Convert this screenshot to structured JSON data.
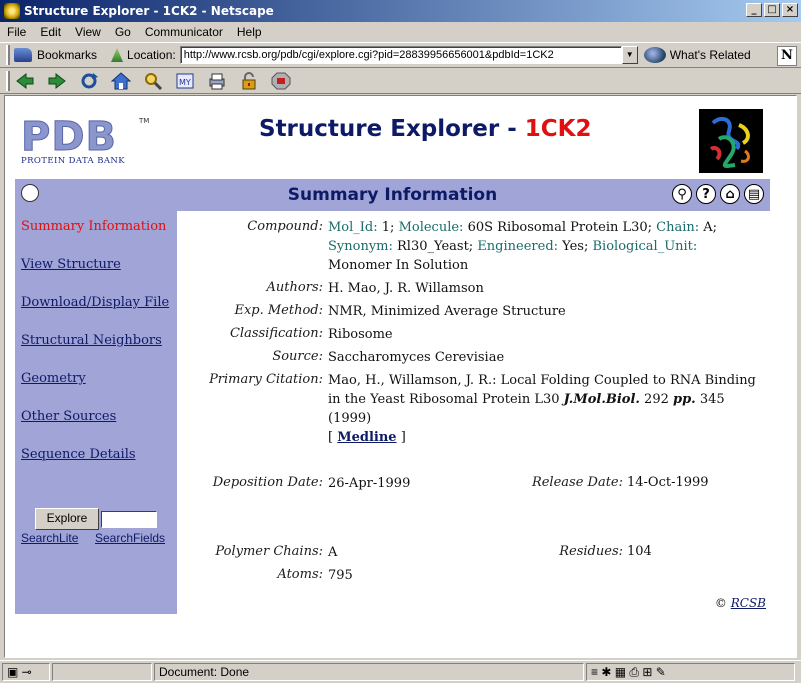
{
  "window": {
    "title": "Structure Explorer - 1CK2 - Netscape",
    "buttons": [
      "_",
      "□",
      "×"
    ]
  },
  "menu": [
    "File",
    "Edit",
    "View",
    "Go",
    "Communicator",
    "Help"
  ],
  "location": {
    "bookmarks_label": "Bookmarks",
    "location_label": "Location:",
    "url": "http://www.rcsb.org/pdb/cgi/explore.cgi?pid=28839956656001&pdbId=1CK2",
    "whats_related": "What's Related",
    "logo": "N"
  },
  "nav_icons": [
    "back-icon",
    "forward-icon",
    "reload-icon",
    "home-icon",
    "search-icon",
    "my-netscape-icon",
    "print-icon",
    "security-icon",
    "stop-icon"
  ],
  "page": {
    "logo_letters": "PDB",
    "logo_tm": "TM",
    "logo_sub": "PROTEIN DATA BANK",
    "heading_prefix": "Structure Explorer - ",
    "heading_id": "1CK2",
    "summary_title": "Summary Information",
    "sidebar": [
      "Summary Information",
      "View Structure",
      "Download/Display File",
      "Structural Neighbors",
      "Geometry",
      "Other Sources",
      "Sequence Details"
    ],
    "explore_button": "Explore",
    "searchlite": "SearchLite",
    "searchfields": "SearchFields",
    "fields": {
      "compound_label": "Compound:",
      "mol_id_key": "Mol_Id:",
      "mol_id_val": " 1; ",
      "molecule_key": "Molecule:",
      "molecule_val": " 60S Ribosomal Protein L30; ",
      "chain_key": "Chain:",
      "chain_val": " A;",
      "synonym_key": "Synonym:",
      "synonym_val": " Rl30_Yeast; ",
      "engineered_key": "Engineered:",
      "engineered_val": " Yes; ",
      "bio_unit_key": "Biological_Unit:",
      "bio_unit_val": "Monomer In Solution",
      "authors_label": "Authors:",
      "authors_val": "H. Mao, J. R. Willamson",
      "exp_label": "Exp. Method:",
      "exp_val": "NMR, Minimized Average Structure",
      "class_label": "Classification:",
      "class_val": "Ribosome",
      "source_label": "Source:",
      "source_val": "Saccharomyces Cerevisiae",
      "citation_label": "Primary Citation:",
      "citation_text": "Mao, H., Willamson, J. R.: Local Folding Coupled to RNA Binding in the Yeast Ribosomal Protein L30 ",
      "citation_journal": "J.Mol.Biol.",
      "citation_vol": " 292 ",
      "citation_pp": "pp.",
      "citation_pages": " 345 (1999)",
      "medline_open": "[ ",
      "medline": "Medline",
      "medline_close": " ]",
      "deposition_label": "Deposition Date:",
      "deposition_val": "26-Apr-1999",
      "release_label": "Release Date:",
      "release_val": "14-Oct-1999",
      "chains_label": "Polymer Chains:",
      "chains_val": "A",
      "residues_label": "Residues:",
      "residues_val": "104",
      "atoms_label": "Atoms:",
      "atoms_val": "795"
    },
    "copyright_symbol": "© ",
    "copyright_link": "RCSB"
  },
  "status": {
    "text": "Document: Done"
  }
}
